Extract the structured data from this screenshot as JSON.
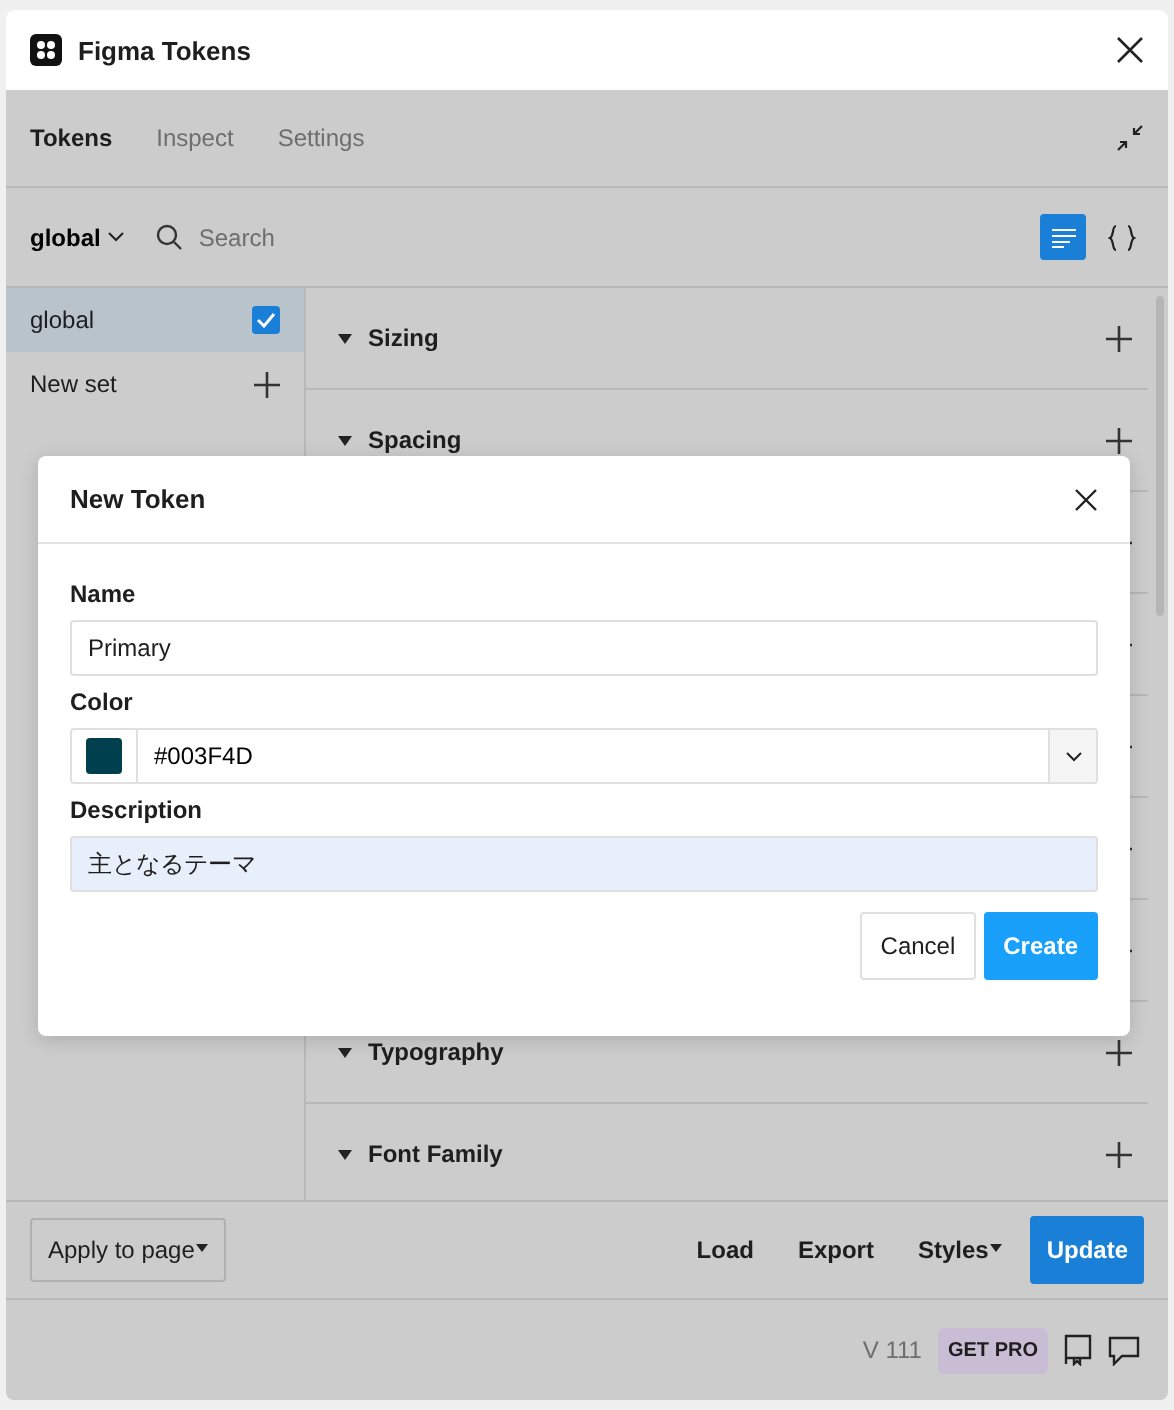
{
  "window": {
    "title": "Figma Tokens"
  },
  "tabs": [
    {
      "label": "Tokens",
      "selected": true
    },
    {
      "label": "Inspect",
      "selected": false
    },
    {
      "label": "Settings",
      "selected": false
    }
  ],
  "toolbar": {
    "set_menu": "global",
    "search": {
      "placeholder": "Search"
    },
    "view_modes": [
      {
        "kind": "list",
        "selected": true
      },
      {
        "kind": "json",
        "selected": false
      }
    ]
  },
  "sets": [
    {
      "kind": "set",
      "label": "global",
      "selected": true,
      "checked": true
    },
    {
      "kind": "new",
      "label": "New set"
    }
  ],
  "token_groups": [
    {
      "kind": "group",
      "title": "Sizing"
    },
    {
      "kind": "group",
      "title": "Spacing"
    },
    {
      "kind": "covered"
    },
    {
      "kind": "covered"
    },
    {
      "kind": "covered"
    },
    {
      "kind": "covered"
    },
    {
      "kind": "covered"
    },
    {
      "kind": "group",
      "title": "Typography"
    },
    {
      "kind": "group",
      "title": "Font Family"
    }
  ],
  "dialog": {
    "title": "New Token",
    "name_label": "Name",
    "name_value": "Primary",
    "color_label": "Color",
    "color_value": "#003F4D",
    "color": "#003f4d",
    "description_label": "Description",
    "description_value": "主となるテーマ",
    "buttons": [
      {
        "label": "Cancel",
        "kind": "secondary"
      },
      {
        "label": "Create",
        "kind": "primary"
      }
    ]
  },
  "footer": {
    "apply_menu": "Apply to page",
    "actions": [
      {
        "label": "Load",
        "kind": "plain"
      },
      {
        "label": "Export",
        "kind": "plain"
      },
      {
        "label": "Styles",
        "kind": "menu"
      },
      {
        "label": "Update",
        "kind": "primary"
      }
    ]
  },
  "status_bar": {
    "version": "V 111",
    "pro_badge": "GET PRO"
  }
}
